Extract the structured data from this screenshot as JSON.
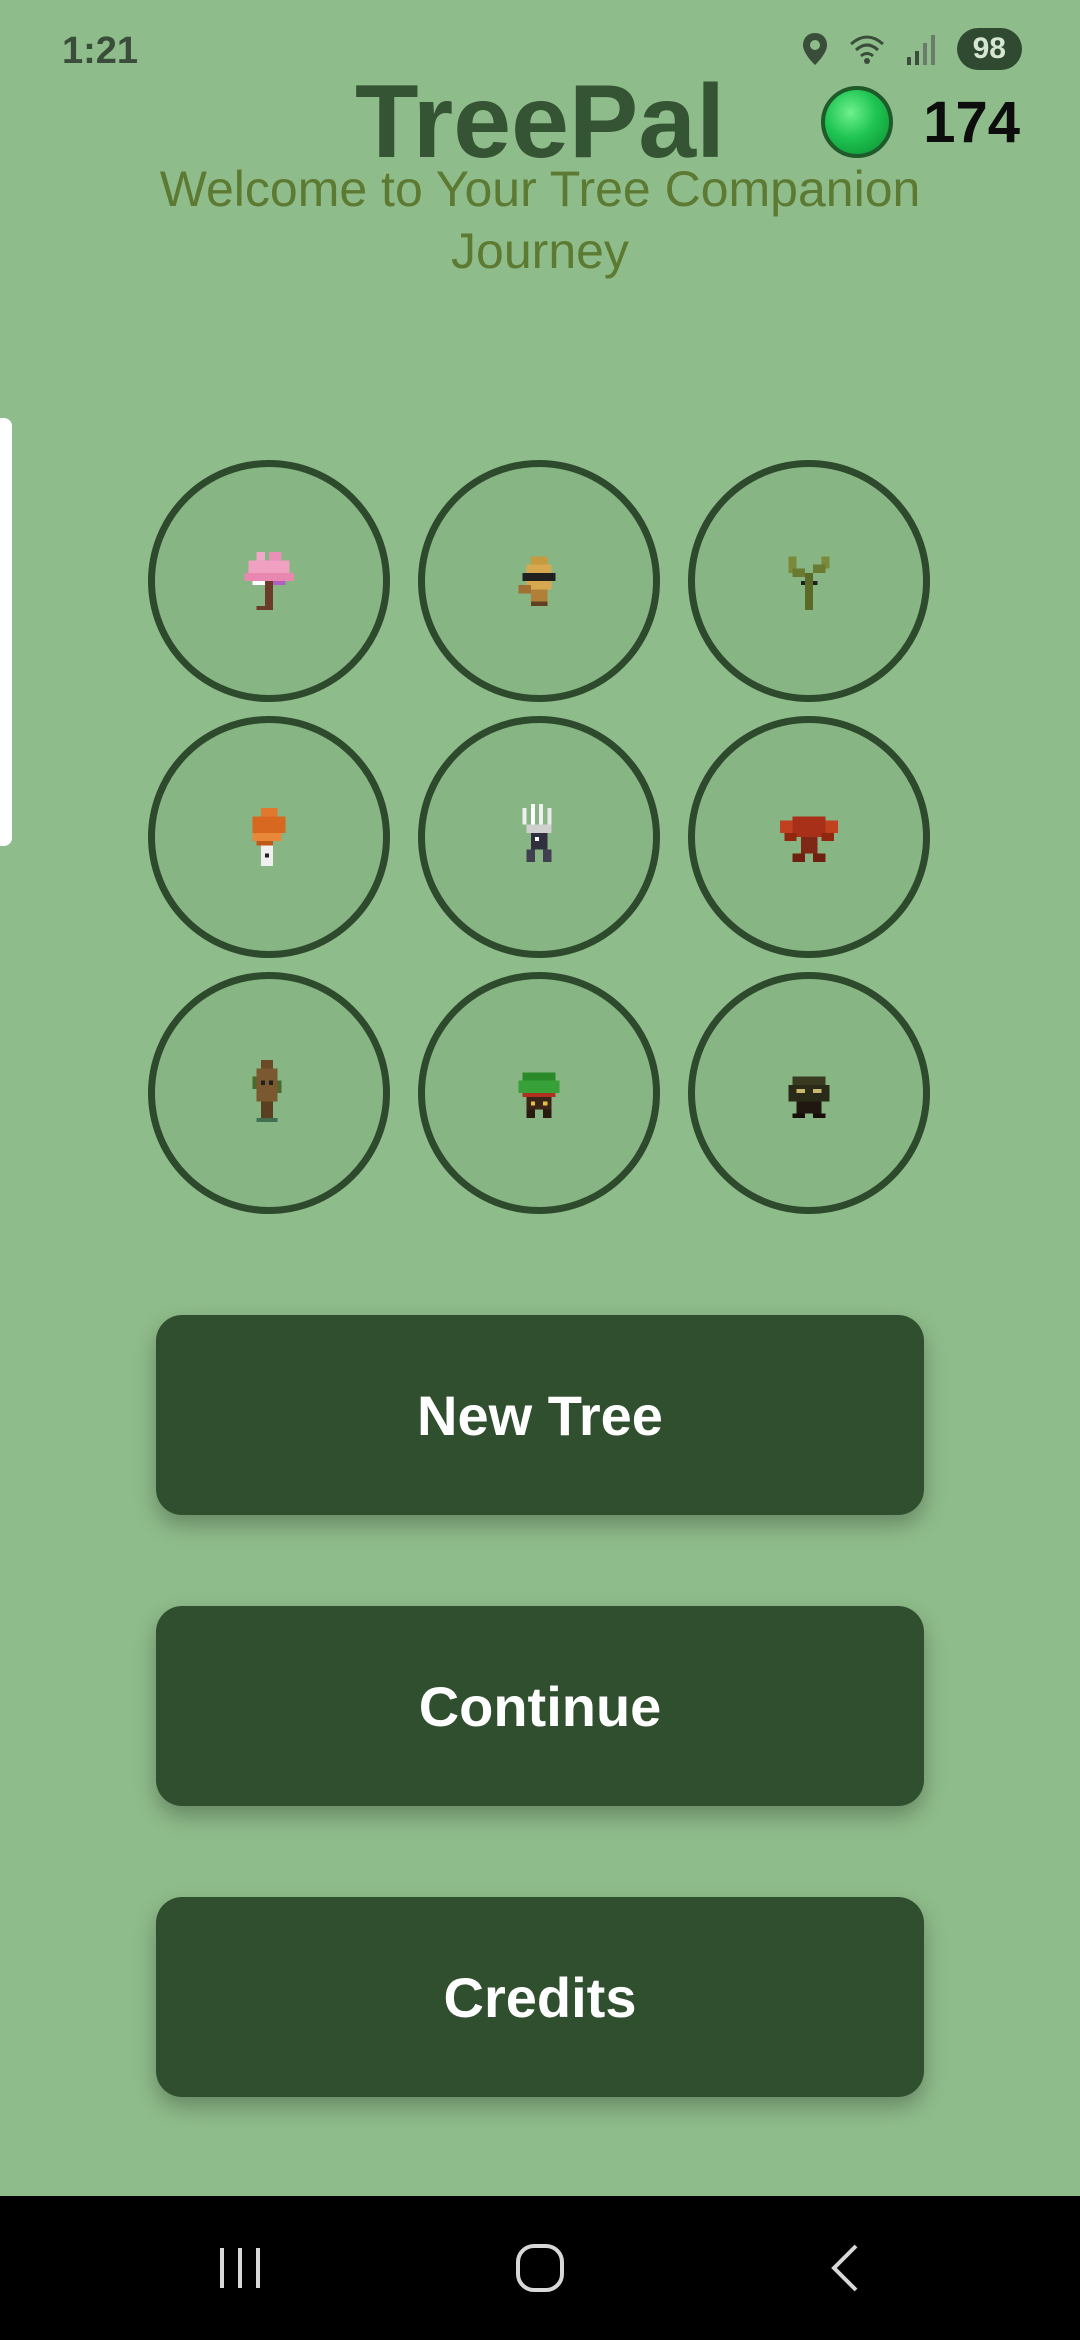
{
  "status_bar": {
    "time": "1:21",
    "battery": "98",
    "icons": [
      "location-icon",
      "wifi-icon",
      "signal-icon",
      "battery-icon"
    ]
  },
  "header": {
    "title": "TreePal",
    "subtitle_line1": "Welcome to Your Tree Companion",
    "subtitle_line2": "Journey",
    "coin_count": "174"
  },
  "trees": [
    {
      "id": "cherry-blossom-tree",
      "icon": "pink-blossom-sprite"
    },
    {
      "id": "sunglasses-sprout",
      "icon": "sunglasses-sprite"
    },
    {
      "id": "slingshot-sapling",
      "icon": "slingshot-sprite"
    },
    {
      "id": "autumn-tree",
      "icon": "orange-tree-sprite"
    },
    {
      "id": "white-spike-tree",
      "icon": "white-spike-sprite"
    },
    {
      "id": "red-spread-tree",
      "icon": "red-tree-sprite"
    },
    {
      "id": "brown-vine-tree",
      "icon": "brown-vine-sprite"
    },
    {
      "id": "leafy-bush-tree",
      "icon": "green-bush-sprite"
    },
    {
      "id": "dark-mushroom-tree",
      "icon": "dark-bush-sprite"
    }
  ],
  "buttons": {
    "new_tree": "New Tree",
    "continue": "Continue",
    "credits": "Credits"
  },
  "colors": {
    "background": "#8fbc8b",
    "button": "#304f2f",
    "title": "#345433",
    "subtitle": "#5d7a33",
    "coin": "#1fc552"
  }
}
